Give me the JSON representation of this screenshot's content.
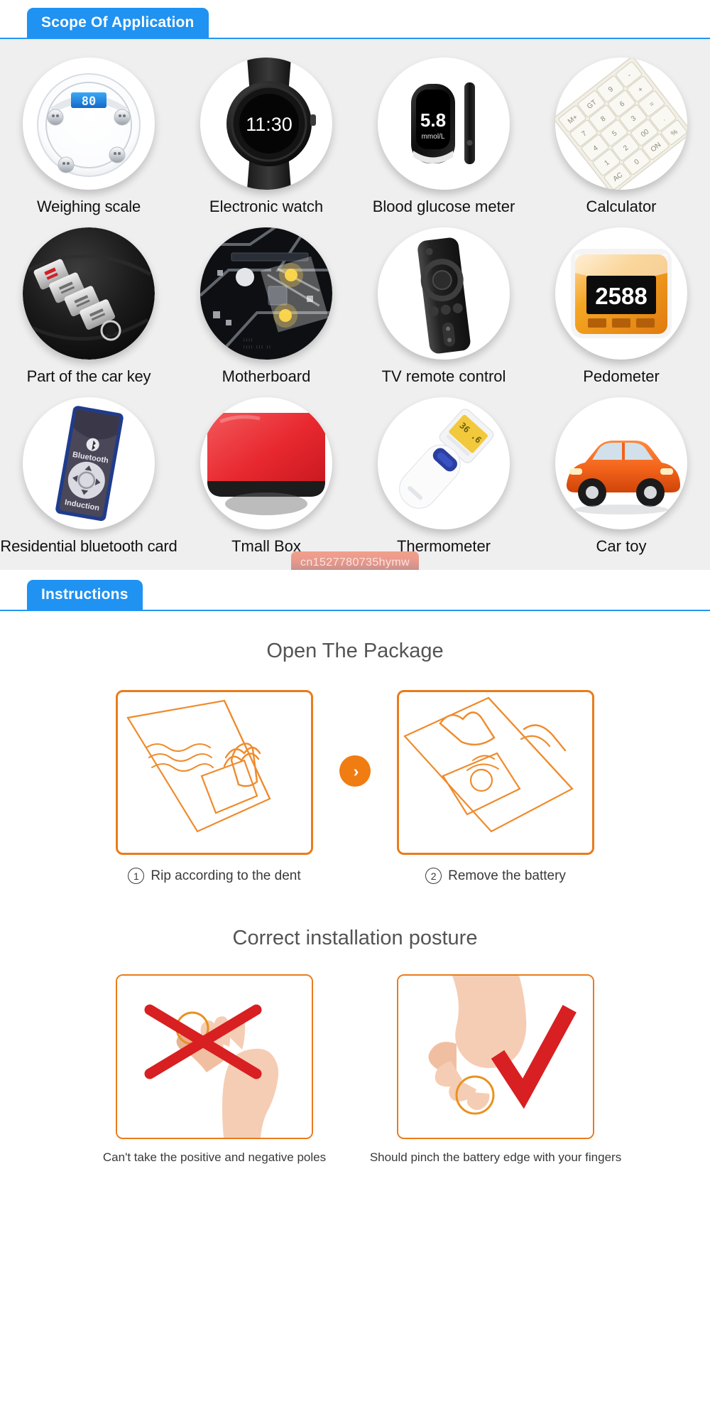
{
  "sections": {
    "scope": {
      "tab_label": "Scope Of Application",
      "accent_color": "#1f92f2",
      "panel_bg": "#efefef",
      "items": [
        {
          "label": "Weighing scale",
          "icon": "weighing-scale-icon",
          "display_value": "80"
        },
        {
          "label": "Electronic watch",
          "icon": "smartwatch-icon",
          "display_value": "11:30"
        },
        {
          "label": "Blood glucose meter",
          "icon": "glucose-meter-icon",
          "display_value": "5.8",
          "display_unit": "mmol/L"
        },
        {
          "label": "Calculator",
          "icon": "calculator-icon",
          "keys": [
            "M+",
            "GT",
            "9",
            "8",
            "7",
            "6",
            "5",
            "4",
            "3",
            "2",
            "1",
            "0",
            "00",
            "AC",
            "ON/CE",
            "+",
            "-",
            "=",
            "."
          ]
        },
        {
          "label": "Part of the car key",
          "icon": "car-key-fob-icon"
        },
        {
          "label": "Motherboard",
          "icon": "motherboard-icon"
        },
        {
          "label": "TV remote control",
          "icon": "tv-remote-icon"
        },
        {
          "label": "Pedometer",
          "icon": "pedometer-icon",
          "display_value": "2588"
        },
        {
          "label": "Residential bluetooth card",
          "icon": "bluetooth-card-icon",
          "text_top": "Bluetooth",
          "text_bottom": "Induction"
        },
        {
          "label": "Tmall Box",
          "icon": "tmall-box-icon"
        },
        {
          "label": "Thermometer",
          "icon": "infrared-thermometer-icon"
        },
        {
          "label": "Car toy",
          "icon": "toy-car-icon"
        }
      ],
      "watermark": "cn1527780735hymw"
    },
    "instructions": {
      "tab_label": "Instructions",
      "accent_color": "#1f92f2",
      "open_package": {
        "heading": "Open The Package",
        "arrow_glyph": "›",
        "steps": [
          {
            "number": "①",
            "caption": "Rip according to the dent"
          },
          {
            "number": "②",
            "caption": "Remove the battery"
          }
        ]
      },
      "posture": {
        "heading": "Correct installation posture",
        "items": [
          {
            "mark": "cross",
            "caption": "Can't take the positive and negative poles"
          },
          {
            "mark": "check",
            "caption": "Should pinch the battery edge with your fingers"
          }
        ]
      },
      "box_border_color": "#ea7b1b",
      "cross_color": "#d81f21",
      "check_color": "#d81f21"
    }
  }
}
